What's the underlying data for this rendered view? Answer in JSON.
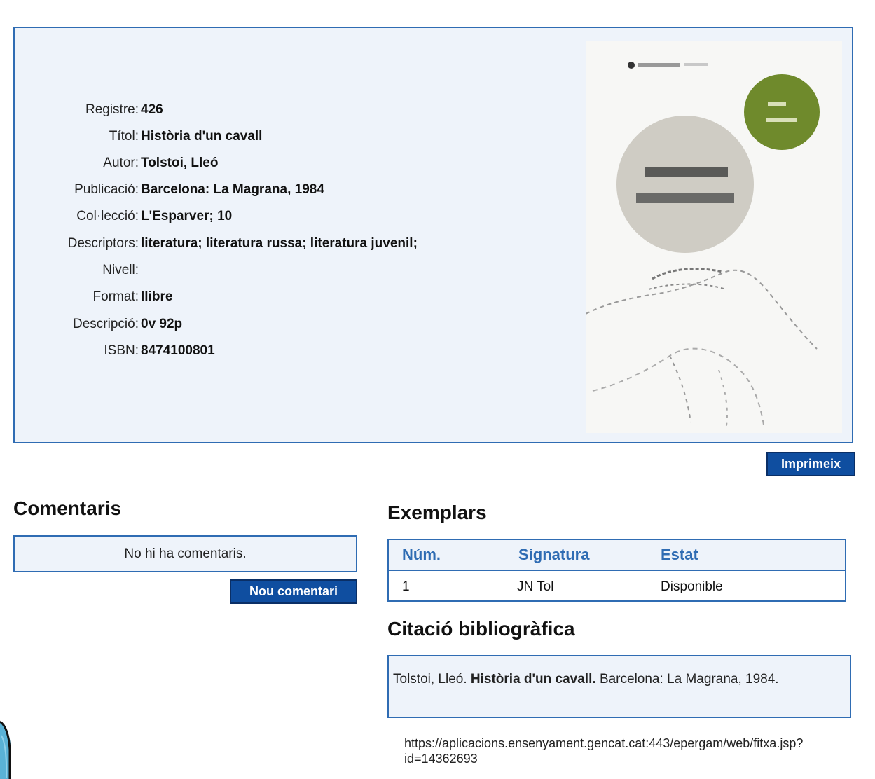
{
  "record": {
    "fields": [
      {
        "label": "Registre:",
        "value": "426"
      },
      {
        "label": "Títol:",
        "value": "Història d'un cavall"
      },
      {
        "label": "Autor:",
        "value": "Tolstoi, Lleó"
      },
      {
        "label": "Publicació:",
        "value": "Barcelona: La Magrana, 1984"
      },
      {
        "label": "Col·lecció:",
        "value": "L'Esparver; 10"
      },
      {
        "label": "Descriptors:",
        "value": "literatura; literatura russa; literatura juvenil;"
      },
      {
        "label": "Nivell:",
        "value": ""
      },
      {
        "label": "Format:",
        "value": "llibre"
      },
      {
        "label": "Descripció:",
        "value": "0v 92p"
      },
      {
        "label": "ISBN:",
        "value": "8474100801"
      }
    ]
  },
  "print_button": "Imprimeix",
  "comments": {
    "heading": "Comentaris",
    "empty_text": "No hi ha comentaris.",
    "new_button": "Nou comentari"
  },
  "copies": {
    "heading": "Exemplars",
    "columns": [
      "Núm.",
      "Signatura",
      "Estat"
    ],
    "rows": [
      [
        "1",
        "JN Tol",
        "Disponible"
      ]
    ]
  },
  "citation": {
    "heading": "Citació bibliogràfica",
    "author": "Tolstoi, Lleó.",
    "title": "Història d'un cavall.",
    "publisher": "Barcelona: La Magrana, 1984."
  },
  "url": "https://aplicacions.ensenyament.gencat.cat:443/epergam/web/fitxa.jsp?id=14362693",
  "colors": {
    "accent": "#2f6cb3",
    "button": "#0f4ea0",
    "panel": "#eef3fa"
  }
}
